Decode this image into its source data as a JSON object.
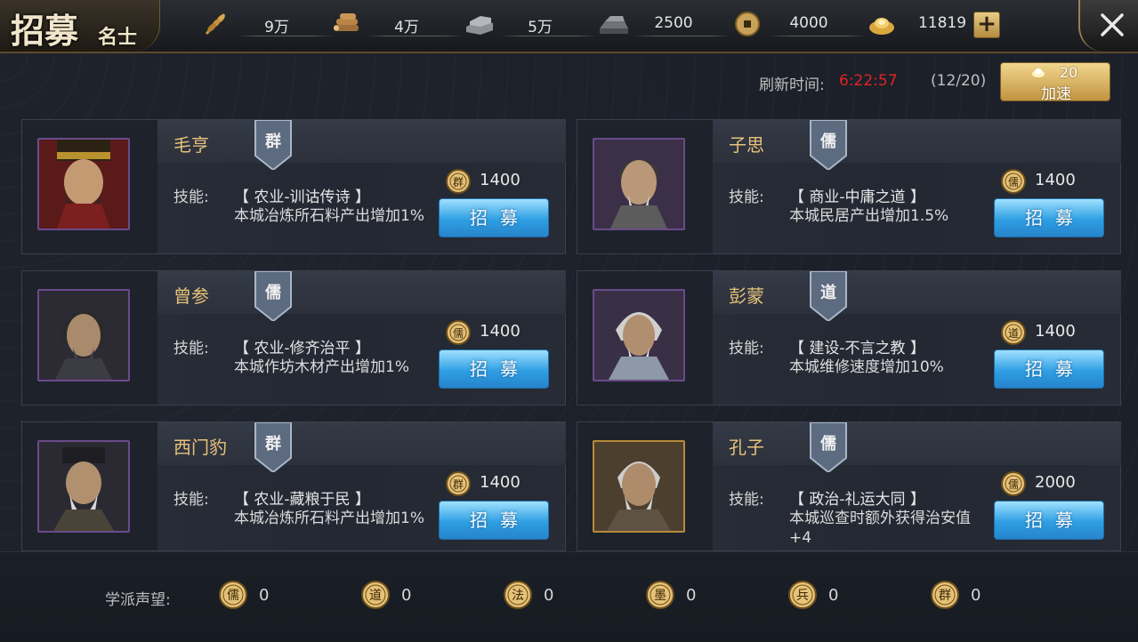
{
  "title": {
    "main": "招募",
    "sub": "名士"
  },
  "resources": [
    {
      "icon": "wheat-icon",
      "value": "9万"
    },
    {
      "icon": "wood-icon",
      "value": "4万"
    },
    {
      "icon": "stone-icon",
      "value": "5万"
    },
    {
      "icon": "iron-icon",
      "value": "2500"
    },
    {
      "icon": "copper-coin-icon",
      "value": "4000"
    },
    {
      "icon": "gold-ingot-icon",
      "value": "11819"
    }
  ],
  "plus_label": "+",
  "refresh": {
    "label": "刷新时间:",
    "time": "6:22:57",
    "count": "(12/20)"
  },
  "speedup": {
    "cost": "20",
    "label": "加速"
  },
  "scholars": [
    {
      "name": "毛亨",
      "school": "群",
      "skill_label": "技能:",
      "skill": "【 农业-训诂传诗 】",
      "desc": "本城冶炼所石料产出增加1%",
      "cost_school": "群",
      "cost": "1400",
      "button": "招募"
    },
    {
      "name": "子思",
      "school": "儒",
      "skill_label": "技能:",
      "skill": "【 商业-中庸之道 】",
      "desc": "本城民居产出增加1.5%",
      "cost_school": "儒",
      "cost": "1400",
      "button": "招募"
    },
    {
      "name": "曾参",
      "school": "儒",
      "skill_label": "技能:",
      "skill": "【 农业-修齐治平 】",
      "desc": "本城作坊木材产出增加1%",
      "cost_school": "儒",
      "cost": "1400",
      "button": "招募"
    },
    {
      "name": "彭蒙",
      "school": "道",
      "skill_label": "技能:",
      "skill": "【 建设-不言之教 】",
      "desc": "本城维修速度增加10%",
      "cost_school": "道",
      "cost": "1400",
      "button": "招募"
    },
    {
      "name": "西门豹",
      "school": "群",
      "skill_label": "技能:",
      "skill": "【 农业-藏粮于民 】",
      "desc": "本城冶炼所石料产出增加1%",
      "cost_school": "群",
      "cost": "1400",
      "button": "招募"
    },
    {
      "name": "孔子",
      "school": "儒",
      "skill_label": "技能:",
      "skill": "【 政治-礼运大同 】",
      "desc": "本城巡查时额外获得治安值+4",
      "cost_school": "儒",
      "cost": "2000",
      "button": "招募"
    }
  ],
  "reputation": {
    "label": "学派声望:",
    "items": [
      {
        "school": "儒",
        "value": "0"
      },
      {
        "school": "道",
        "value": "0"
      },
      {
        "school": "法",
        "value": "0"
      },
      {
        "school": "墨",
        "value": "0"
      },
      {
        "school": "兵",
        "value": "0"
      },
      {
        "school": "群",
        "value": "0"
      }
    ]
  }
}
